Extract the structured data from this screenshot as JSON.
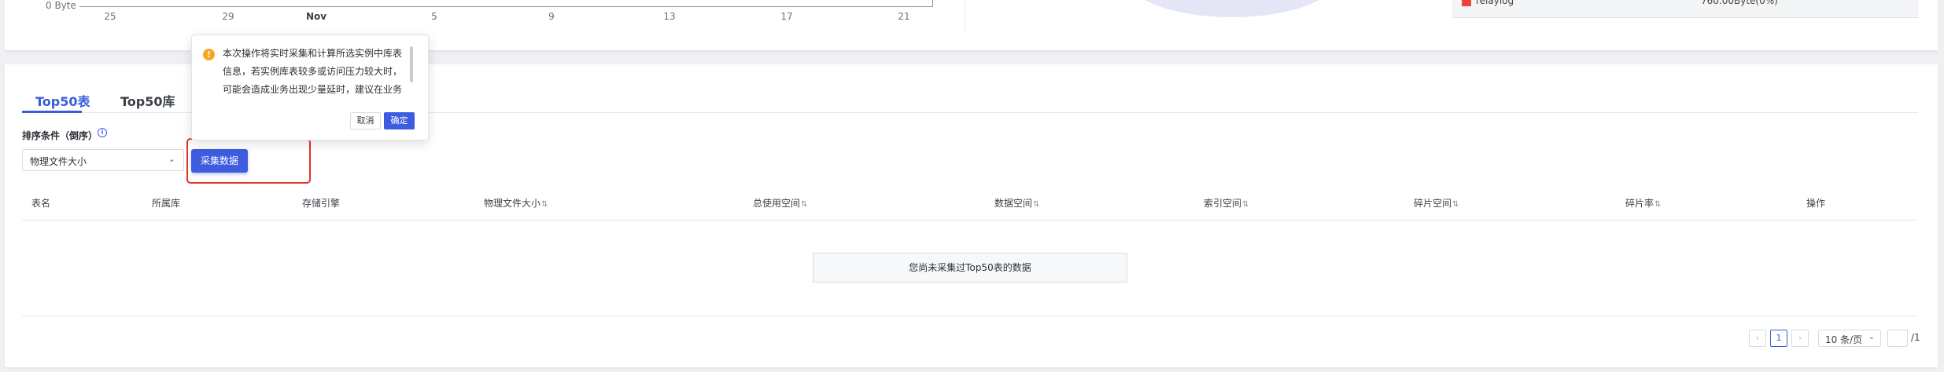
{
  "chart": {
    "y_label": "0 Byte",
    "x_ticks": [
      "25",
      "29",
      "Nov",
      "5",
      "9",
      "13",
      "17",
      "21"
    ]
  },
  "legend": {
    "label": "relaylog",
    "value": "760.00Byte(0%)",
    "color": "#e8463a"
  },
  "tabs": [
    {
      "label": "Top50表"
    },
    {
      "label": "Top50库"
    }
  ],
  "sort": {
    "label": "排序条件（倒序）",
    "selected": "物理文件大小"
  },
  "collect_button": "采集数据",
  "table": {
    "columns": [
      {
        "label": "表名"
      },
      {
        "label": "所属库"
      },
      {
        "label": "存储引擎"
      },
      {
        "label": "物理文件大小"
      },
      {
        "label": "总使用空间"
      },
      {
        "label": "数据空间"
      },
      {
        "label": "索引空间"
      },
      {
        "label": "碎片空间"
      },
      {
        "label": "碎片率"
      },
      {
        "label": "操作"
      }
    ],
    "empty_text": "您尚未采集过Top50表的数据"
  },
  "pagination": {
    "prev": "‹",
    "current": "1",
    "next": "›",
    "page_size": "10 条/页",
    "total": "/1"
  },
  "popover": {
    "warn_icon": "!",
    "text": "本次操作将实时采集和计算所选实例中库表信息，若实例库表较多或访问压力较大时，可能会造成业务出现少量延时，建议在业务",
    "cancel": "取消",
    "ok": "确定"
  },
  "colors": {
    "accent": "#3b5bdb",
    "button": "#3d5ce0",
    "highlight": "#e0352b",
    "warning": "#f5a623"
  }
}
